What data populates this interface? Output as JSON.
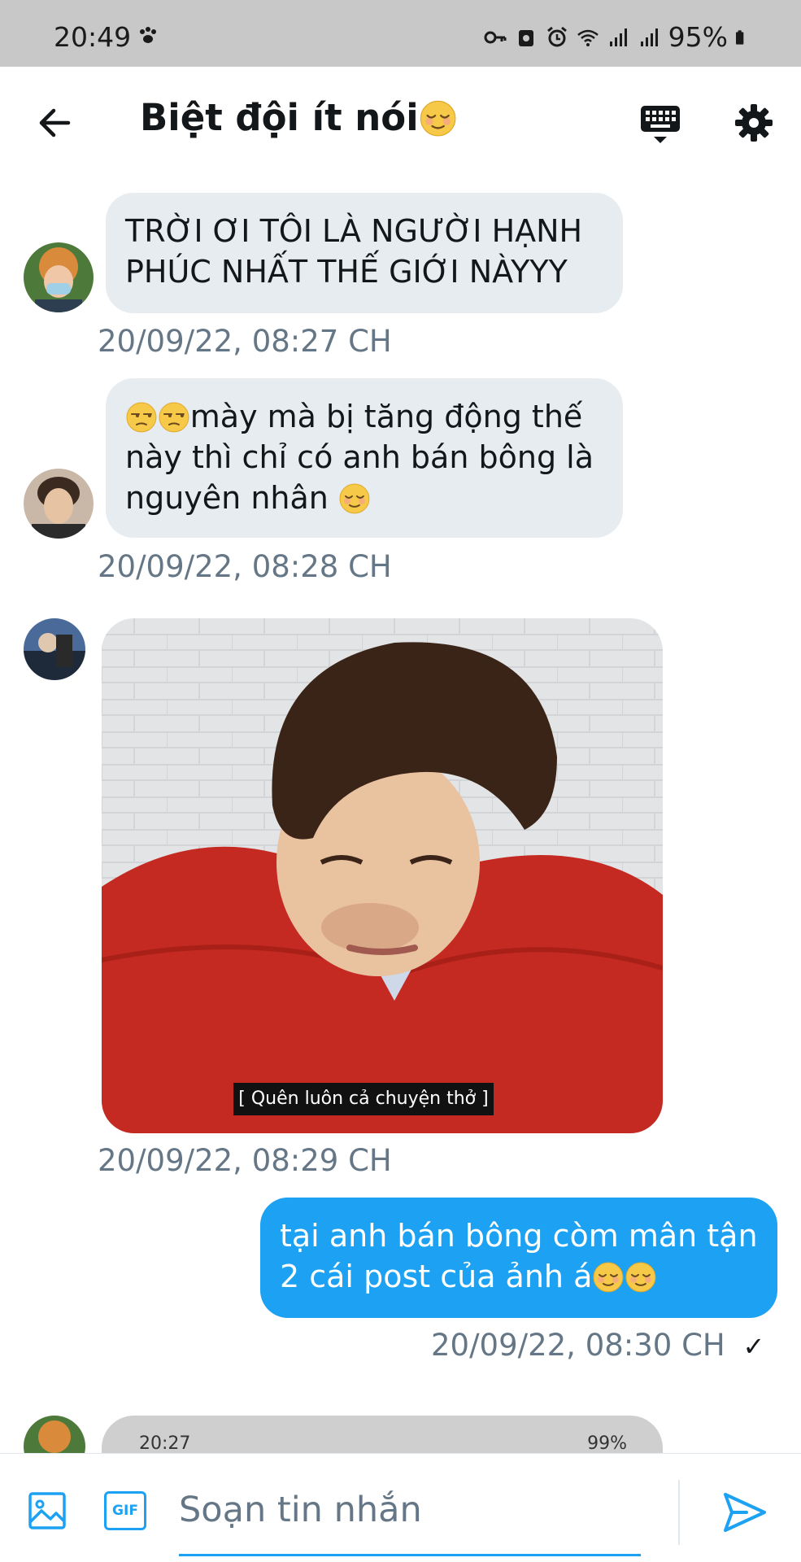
{
  "status_bar": {
    "time": "20:49",
    "battery": "95%"
  },
  "header": {
    "title": "Biệt đội ít nói"
  },
  "messages": [
    {
      "text": "TRỜI ƠI TÔI LÀ NGƯỜI HẠNH PHÚC NHẤT THẾ GIỚI NÀYYY",
      "timestamp": "20/09/22, 08:27 CH"
    },
    {
      "text_line1": "mày mà bị tăng động thế",
      "text_line2": "này thì chỉ có anh bán bông là",
      "text_line3": "nguyên nhân ",
      "timestamp": "20/09/22, 08:28 CH"
    },
    {
      "caption": "[ Quên luôn cả chuyện thở ]",
      "timestamp": "20/09/22, 08:29 CH"
    },
    {
      "text_line1": "tại anh bán bông còm mân tận",
      "text_line2": "2 cái post của ảnh á",
      "timestamp": "20/09/22, 08:30 CH",
      "status": "✓"
    },
    {
      "preview_time": "20:27",
      "preview_battery": "99%"
    }
  ],
  "composer": {
    "placeholder": "Soạn tin nhắn",
    "gif_label": "GIF"
  },
  "colors": {
    "accent": "#1da1f2",
    "bubble_in": "#e6ecf0",
    "muted": "#657786",
    "statusbar": "#c8c8c8"
  },
  "icons": [
    "paw-icon",
    "key-icon",
    "alarm-icon",
    "wifi-icon",
    "signal-icon",
    "battery-icon",
    "back-arrow-icon",
    "keyboard-icon",
    "gear-icon",
    "image-icon",
    "gif-icon",
    "send-icon",
    "relieved-emoji-icon",
    "unamused-emoji-icon"
  ]
}
